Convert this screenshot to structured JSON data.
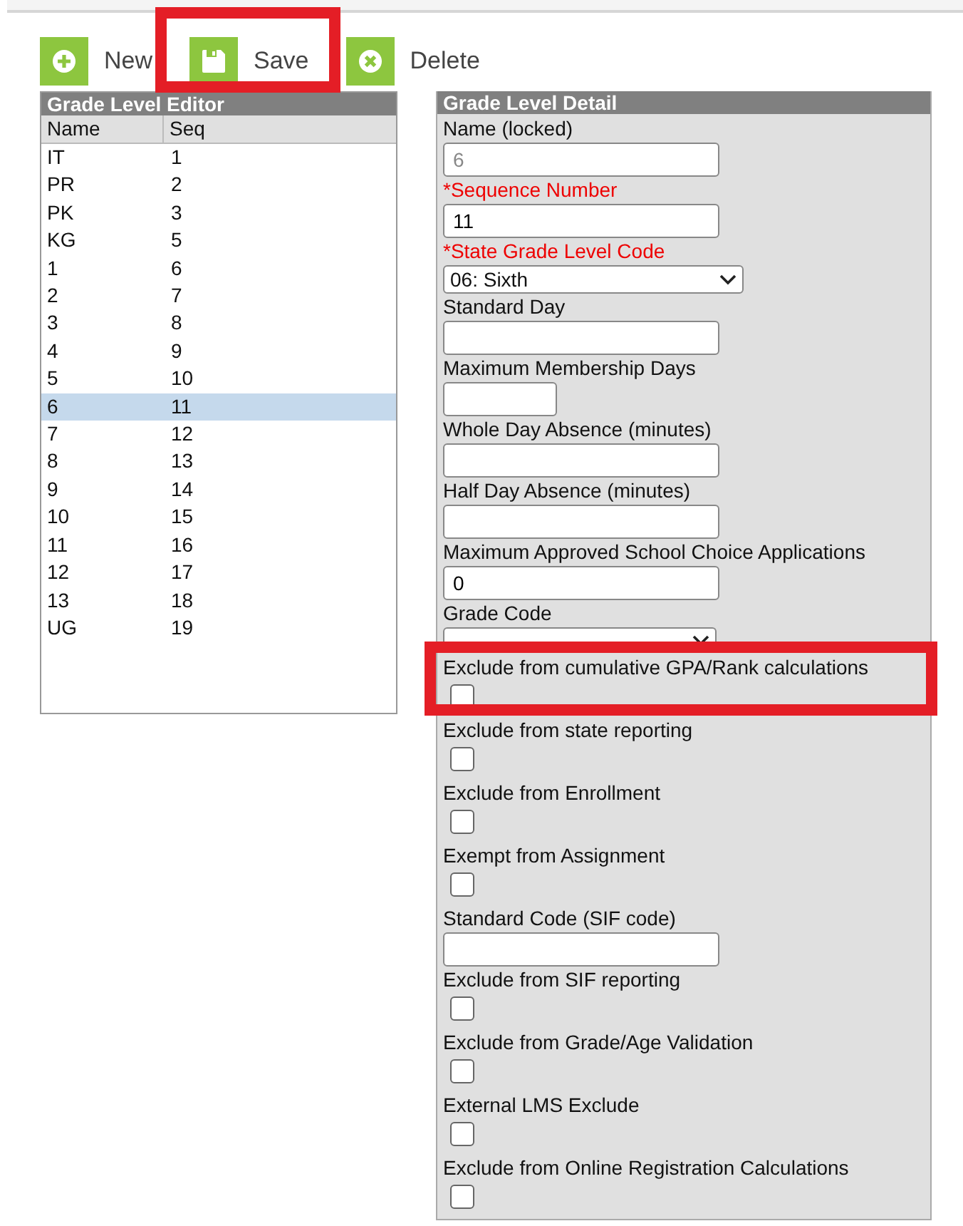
{
  "toolbar": [
    {
      "kind": "new",
      "label": "New",
      "highlighted": false
    },
    {
      "kind": "save",
      "label": "Save",
      "highlighted": true
    },
    {
      "kind": "delete",
      "label": "Delete",
      "highlighted": false
    }
  ],
  "editor": {
    "title": "Grade Level Editor",
    "columns": [
      "Name",
      "Seq"
    ],
    "rows": [
      {
        "name": "IT",
        "seq": "1",
        "selected": false
      },
      {
        "name": "PR",
        "seq": "2",
        "selected": false
      },
      {
        "name": "PK",
        "seq": "3",
        "selected": false
      },
      {
        "name": "KG",
        "seq": "5",
        "selected": false
      },
      {
        "name": "1",
        "seq": "6",
        "selected": false
      },
      {
        "name": "2",
        "seq": "7",
        "selected": false
      },
      {
        "name": "3",
        "seq": "8",
        "selected": false
      },
      {
        "name": "4",
        "seq": "9",
        "selected": false
      },
      {
        "name": "5",
        "seq": "10",
        "selected": false
      },
      {
        "name": "6",
        "seq": "11",
        "selected": true
      },
      {
        "name": "7",
        "seq": "12",
        "selected": false
      },
      {
        "name": "8",
        "seq": "13",
        "selected": false
      },
      {
        "name": "9",
        "seq": "14",
        "selected": false
      },
      {
        "name": "10",
        "seq": "15",
        "selected": false
      },
      {
        "name": "11",
        "seq": "16",
        "selected": false
      },
      {
        "name": "12",
        "seq": "17",
        "selected": false
      },
      {
        "name": "13",
        "seq": "18",
        "selected": false
      },
      {
        "name": "UG",
        "seq": "19",
        "selected": false
      }
    ]
  },
  "detail": {
    "title": "Grade Level Detail",
    "fields": [
      {
        "kind": "text",
        "label": "Name (locked)",
        "value": "6",
        "disabled": true,
        "required": false
      },
      {
        "kind": "text",
        "label": "*Sequence Number",
        "value": "11",
        "required": true
      },
      {
        "kind": "select",
        "label": "*State Grade Level Code",
        "value": "06: Sixth",
        "required": true
      },
      {
        "kind": "text",
        "label": "Standard Day",
        "required": false
      },
      {
        "kind": "short",
        "label": "Maximum Membership Days",
        "required": false
      },
      {
        "kind": "text",
        "label": "Whole Day Absence (minutes)",
        "required": false
      },
      {
        "kind": "text",
        "label": "Half Day Absence (minutes)",
        "required": false
      },
      {
        "kind": "text",
        "label": "Maximum Approved School Choice Applications",
        "value": "0",
        "required": false
      },
      {
        "kind": "select-cut",
        "label": "Grade Code",
        "required": false
      },
      {
        "kind": "checkbox",
        "label": "Exclude from cumulative GPA/Rank calculations",
        "checked": false,
        "required": false,
        "highlighted": true
      },
      {
        "kind": "checkbox",
        "label": "Exclude from state reporting",
        "checked": false,
        "required": false
      },
      {
        "kind": "checkbox",
        "label": "Exclude from Enrollment",
        "checked": false,
        "required": false
      },
      {
        "kind": "checkbox",
        "label": "Exempt from Assignment",
        "checked": false,
        "required": false
      },
      {
        "kind": "text",
        "label": "Standard Code (SIF code)",
        "required": false
      },
      {
        "kind": "checkbox",
        "label": "Exclude from SIF reporting",
        "checked": false,
        "required": false
      },
      {
        "kind": "checkbox",
        "label": "Exclude from Grade/Age Validation",
        "checked": false,
        "required": false
      },
      {
        "kind": "checkbox",
        "label": "External LMS Exclude",
        "checked": false,
        "required": false
      },
      {
        "kind": "checkbox",
        "label": "Exclude from Online Registration Calculations",
        "checked": false,
        "required": false
      }
    ]
  }
}
